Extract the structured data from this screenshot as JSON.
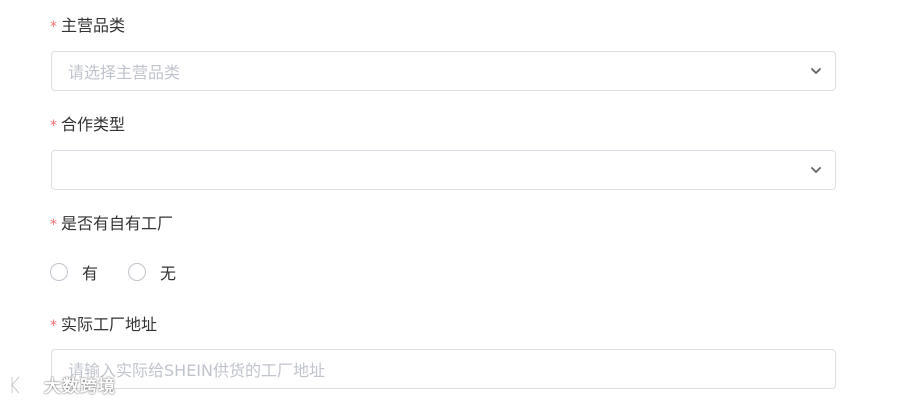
{
  "fields": {
    "category": {
      "required_mark": "*",
      "label": "主营品类",
      "placeholder": "请选择主营品类"
    },
    "cooperation": {
      "required_mark": "*",
      "label": "合作类型",
      "value": ""
    },
    "factory": {
      "required_mark": "*",
      "label": "是否有自有工厂",
      "options": [
        "有",
        "无"
      ],
      "selected": null
    },
    "address": {
      "required_mark": "*",
      "label": "实际工厂地址",
      "placeholder": "请输入实际给SHEIN供货的工厂地址"
    }
  },
  "watermark": {
    "logo_letters": "K",
    "text": "大数跨境"
  },
  "colors": {
    "required": "#f56c6c",
    "border": "#dcdfe6",
    "placeholder": "#c0c4cc",
    "label": "#333333"
  },
  "icons": {
    "select_arrow": "chevron-down-icon"
  }
}
